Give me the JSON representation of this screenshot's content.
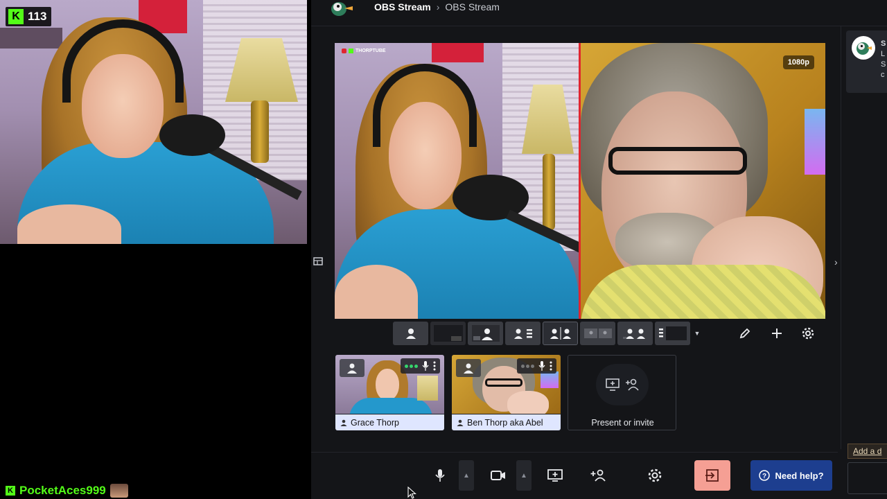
{
  "stream_overlay": {
    "viewer_count": "113",
    "platform_logo": "K",
    "chat": {
      "username": "PocketAces999"
    }
  },
  "studio": {
    "breadcrumb": {
      "main": "OBS Stream",
      "separator": "›",
      "sub": "OBS Stream"
    },
    "stage": {
      "logo_text": "THORPTUBE",
      "resolution_badge": "1080p"
    },
    "participants": [
      {
        "name": "Grace Thorp"
      },
      {
        "name": "Ben Thorp aka Abel"
      }
    ],
    "present_tile": {
      "label": "Present or invite"
    },
    "sidebar": {
      "card_lines": [
        "S",
        "L",
        "S",
        "c"
      ],
      "add_link": "Add a d"
    },
    "controls": {
      "help_label": "Need help?"
    }
  },
  "colors": {
    "app_bg": "#141518",
    "accent_leave": "#f59f94",
    "help_button": "#1d3e8f",
    "tile_label_bg": "#dfe6ff",
    "kick_green": "#53fc18",
    "live_indicator": "#e0262e"
  }
}
